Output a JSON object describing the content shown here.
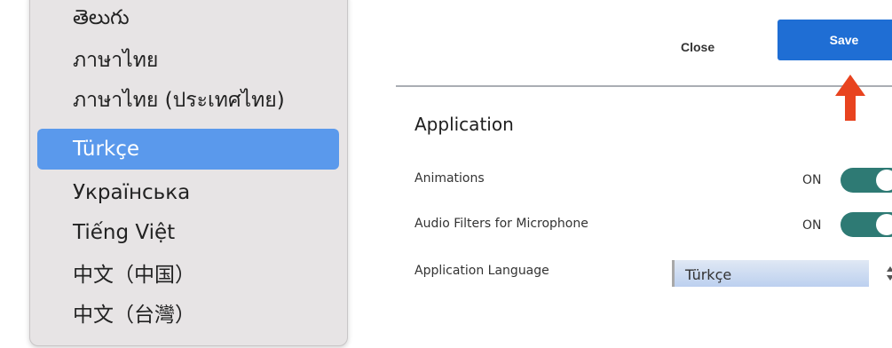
{
  "language_menu": {
    "items": [
      {
        "label": "తెలుగు",
        "selected": false
      },
      {
        "label": "ภาษาไทย",
        "selected": false
      },
      {
        "label": "ภาษาไทย (ประเทศไทย)",
        "selected": false
      },
      {
        "label": "Türkçe",
        "selected": true
      },
      {
        "label": "Українська",
        "selected": false
      },
      {
        "label": "Tiếng Việt",
        "selected": false
      },
      {
        "label": "中文（中国）",
        "selected": false
      },
      {
        "label": "中文（台灣）",
        "selected": false
      }
    ],
    "selected_color": "#5a99ec"
  },
  "toolbar": {
    "close_label": "Close",
    "save_label": "Save",
    "save_color": "#1f6ed4"
  },
  "annotation": {
    "icon": "up-arrow-icon",
    "color": "#e8431f"
  },
  "section": {
    "title": "Application"
  },
  "settings": {
    "animations": {
      "label": "Animations",
      "state": "ON",
      "enabled": true
    },
    "audio_filters": {
      "label": "Audio Filters for Microphone",
      "state": "ON",
      "enabled": true
    },
    "application_language": {
      "label": "Application Language",
      "value": "Türkçe"
    }
  },
  "toggle_color": "#2e7a74"
}
